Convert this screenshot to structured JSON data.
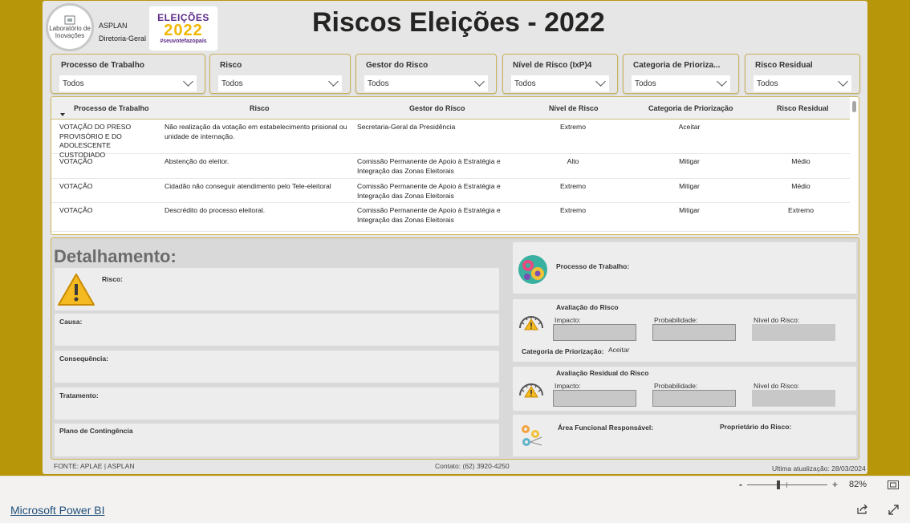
{
  "header": {
    "logo_text": "Laboratório de Inovações",
    "org_line1": "ASPLAN",
    "org_line2": "Diretoria-Geral",
    "election_logo_line1": "ELEIÇÕES",
    "election_logo_line2": "2022",
    "election_logo_line3": "#seuvotefazopaís",
    "title": "Riscos Eleições - 2022"
  },
  "slicers": [
    {
      "label": "Processo de Trabalho",
      "value": "Todos"
    },
    {
      "label": "Risco",
      "value": "Todos"
    },
    {
      "label": "Gestor do Risco",
      "value": "Todos"
    },
    {
      "label": "Nível de Risco (IxP)4",
      "value": "Todos"
    },
    {
      "label": "Categoria de Prioriza...",
      "value": "Todos"
    },
    {
      "label": "Risco Residual",
      "value": "Todos"
    }
  ],
  "table": {
    "columns": [
      "Processo de Trabalho",
      "Risco",
      "Gestor do Risco",
      "Nível de Risco",
      "Categoria de Priorização",
      "Risco Residual"
    ],
    "rows": [
      {
        "processo": "VOTAÇÃO DO PRESO PROVISÓRIO E DO ADOLESCENTE CUSTODIADO",
        "risco": "Não realização da votação em estabelecimento prisional ou unidade de internação.",
        "gestor": "Secretaria-Geral da Presidência",
        "nivel": "Extremo",
        "categoria": "Aceitar",
        "residual": ""
      },
      {
        "processo": "VOTAÇÃO",
        "risco": "Abstenção do eleitor.",
        "gestor": "Comissão Permanente de Apoio à Estratégia e Integração das Zonas Eleitorais",
        "nivel": "Alto",
        "categoria": "Mitigar",
        "residual": "Médio"
      },
      {
        "processo": "VOTAÇÃO",
        "risco": "Cidadão não conseguir atendimento pelo Tele-eleitoral",
        "gestor": "Comissão Permanente de Apoio à Estratégia e Integração das Zonas Eleitorais",
        "nivel": "Extremo",
        "categoria": "Mitigar",
        "residual": "Médio"
      },
      {
        "processo": "VOTAÇÃO",
        "risco": "Descrédito do processo eleitoral.",
        "gestor": "Comissão Permanente de Apoio à Estratégia e Integração das Zonas Eleitorais",
        "nivel": "Extremo",
        "categoria": "Mitigar",
        "residual": "Extremo"
      }
    ]
  },
  "detail": {
    "title": "Detalhamento:",
    "risco_label": "Risco:",
    "causa_label": "Causa:",
    "consequencia_label": "Consequência:",
    "tratamento_label": "Tratamento:",
    "plano_label": "Plano de Contingência",
    "processo_label": "Processo de Trabalho:",
    "avaliacao_title": "Avaliação do Risco",
    "impacto_label": "Impacto:",
    "probabilidade_label": "Probabilidade:",
    "nivel_label": "Nível do Risco:",
    "categoria_label": "Categoria de Priorização:",
    "categoria_value": "Aceitar",
    "residual_title": "Avaliação Residual do Risco",
    "area_label": "Área Funcional Responsável:",
    "proprietario_label": "Proprietário do Risco:"
  },
  "footer": {
    "fonte": "FONTE: APLAE | ASPLAN",
    "contato": "Contato: (62) 3920-4250",
    "atualizacao": "Ultima atualização: 28/03/2024"
  },
  "powerbi": {
    "brand_link": "Microsoft Power BI",
    "zoom_minus": "-",
    "zoom_plus": "+",
    "zoom_level": "82%"
  },
  "colors": {
    "frame": "#b8960a",
    "slicer_border": "#c9b35a",
    "warning": "#f5b921"
  }
}
